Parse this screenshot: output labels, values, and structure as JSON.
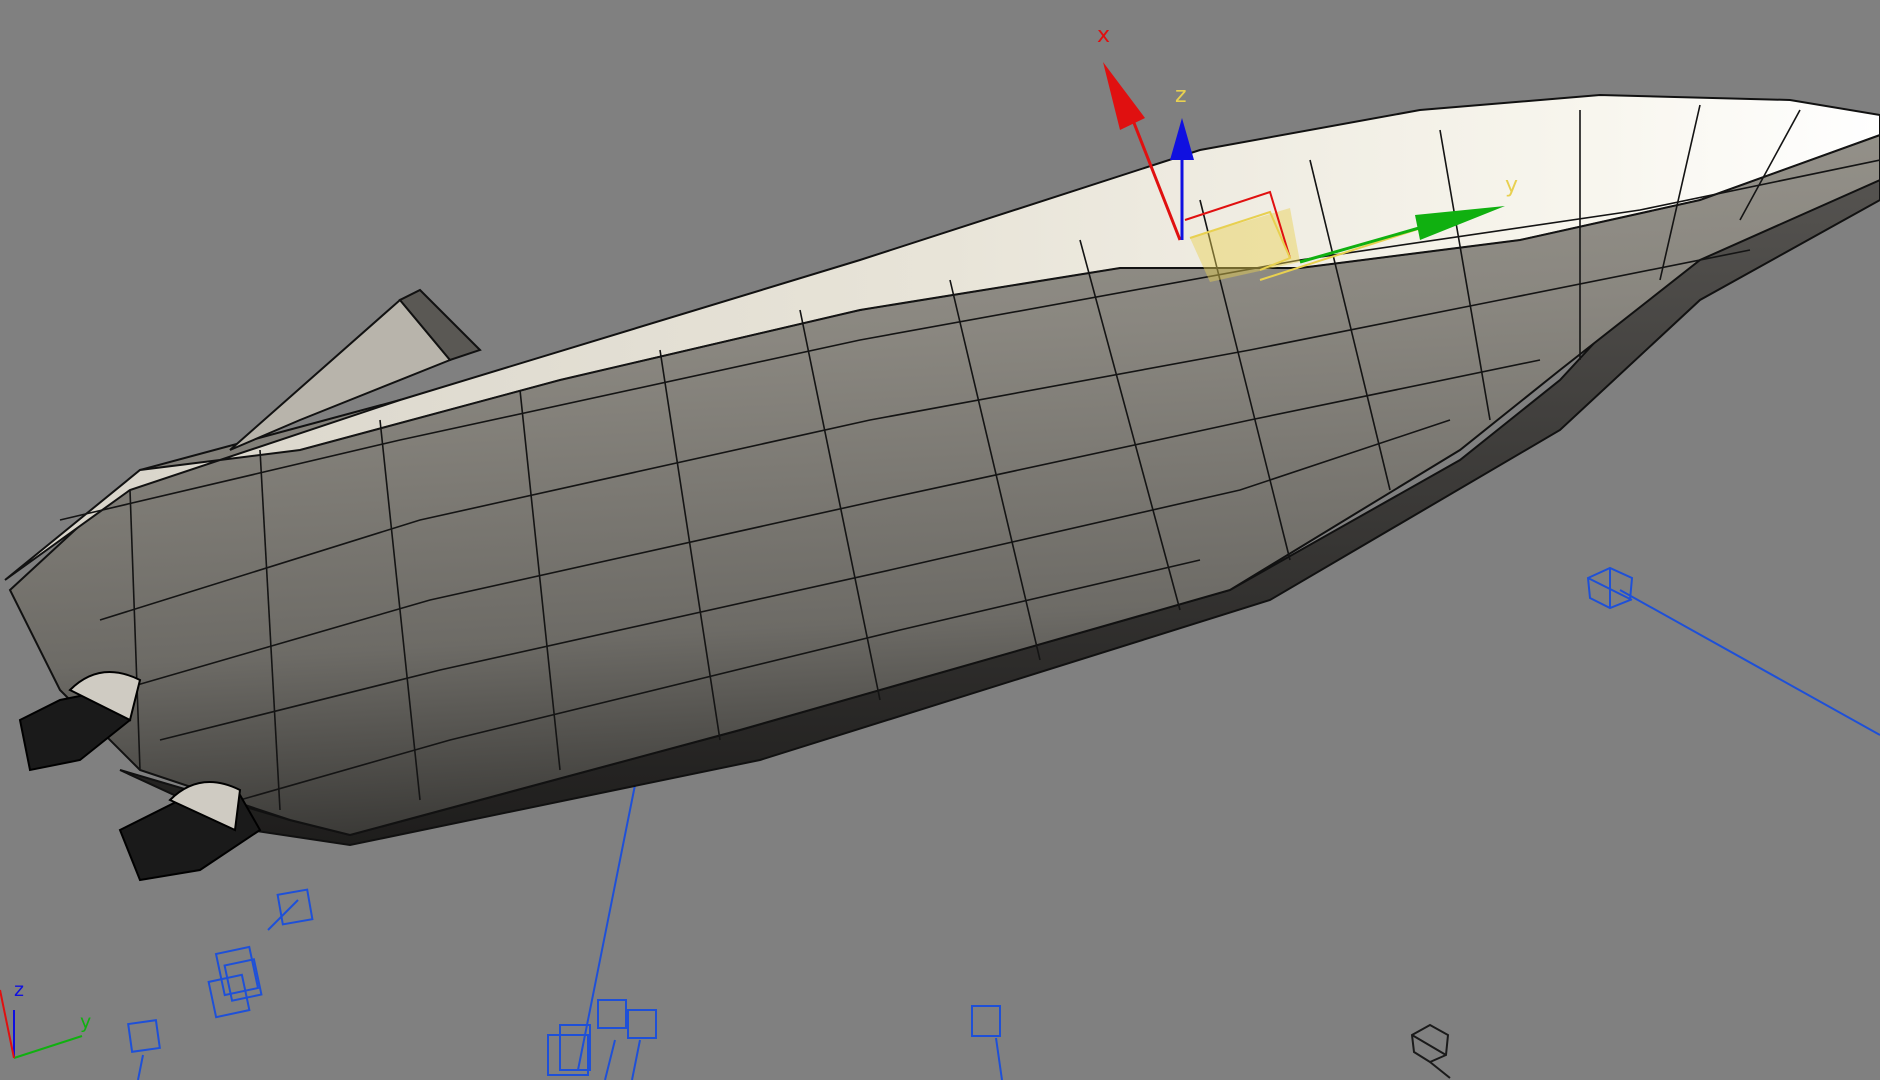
{
  "viewport": {
    "background": "#808080",
    "model": "speedboat-hull-wireframe-shaded"
  },
  "gizmo": {
    "axis_x": "x",
    "axis_y": "y",
    "axis_z": "z",
    "colors": {
      "x": "#e01010",
      "y": "#10b010",
      "z": "#1010e0",
      "plane": "#e8d050"
    }
  },
  "view_triad": {
    "axis_y": "y",
    "axis_z": "z",
    "colors": {
      "x": "#e01010",
      "y": "#10b010",
      "z": "#1010e0"
    }
  },
  "helpers": {
    "color": "#1e50d8",
    "icons": [
      "camera-icon",
      "light-icon",
      "target-icon"
    ]
  }
}
